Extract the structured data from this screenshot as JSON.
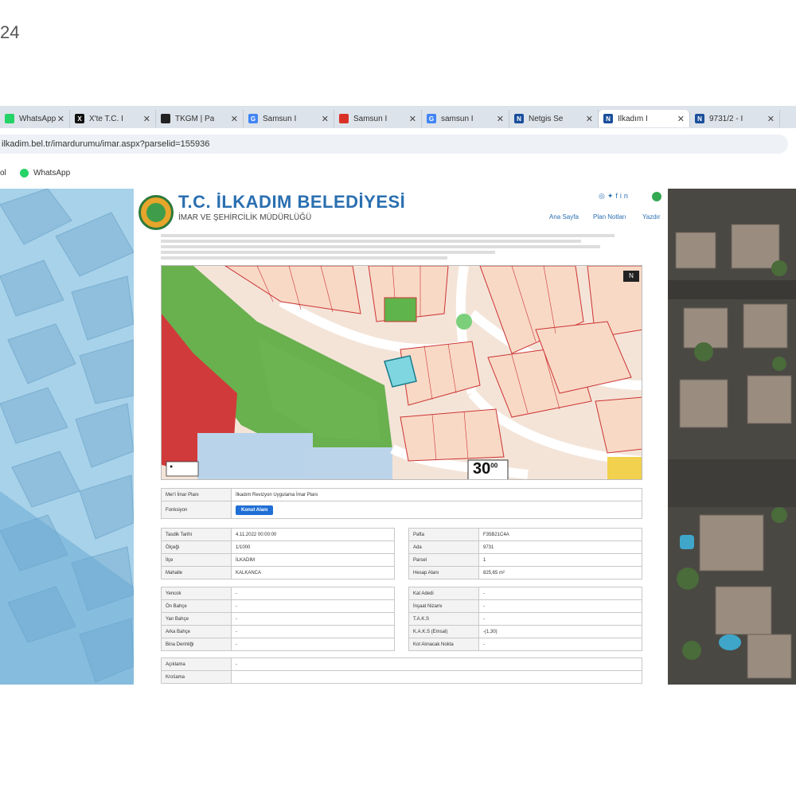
{
  "header_text": "24",
  "browser": {
    "tabs": [
      {
        "label": "WhatsApp",
        "icon": "whatsapp-icon",
        "color": "#25d366",
        "glyph": ""
      },
      {
        "label": "X'te T.C. İ",
        "icon": "x-icon",
        "color": "#111111",
        "glyph": "X"
      },
      {
        "label": "TKGM | Pa",
        "icon": "map-pin-icon",
        "color": "#222222",
        "glyph": ""
      },
      {
        "label": "Samsun İ",
        "icon": "google-icon",
        "color": "#4285f4",
        "glyph": "G"
      },
      {
        "label": "Samsun İ",
        "icon": "site-icon",
        "color": "#d93025",
        "glyph": ""
      },
      {
        "label": "samsun İ",
        "icon": "google-icon",
        "color": "#4285f4",
        "glyph": "G"
      },
      {
        "label": "Netgis Se",
        "icon": "netgis-icon",
        "color": "#1a4f9c",
        "glyph": "N"
      },
      {
        "label": "İlkadım İ",
        "icon": "netgis-icon",
        "color": "#1a4f9c",
        "glyph": "N"
      },
      {
        "label": "9731/2 - İ",
        "icon": "netgis-icon",
        "color": "#1a4f9c",
        "glyph": "N"
      }
    ],
    "url": "ilkadim.bel.tr/imardurumu/imar.aspx?parselid=155936",
    "bookmarks": [
      {
        "label": "ol"
      },
      {
        "label": "WhatsApp"
      }
    ]
  },
  "site": {
    "title": "T.C. İLKADIM BELEDİYESİ",
    "subtitle": "İMAR VE ŞEHİRCİLİK MÜDÜRLÜĞÜ",
    "nav": [
      "Ana Sayfa",
      "Plan Notları",
      "Yazdır"
    ],
    "social_icons": [
      "instagram-icon",
      "twitter-icon",
      "facebook-icon",
      "linkedin-icon"
    ],
    "map": {
      "scale_label": "30",
      "scale_super": "00",
      "north_label": "N"
    },
    "plan": {
      "plan_label": "Mer'i İmar Planı",
      "plan_value": "İlkadım Revizyon Uygulama İmar Planı",
      "function_label": "Fonksiyon",
      "function_button": "Konut Alanı"
    },
    "left_table": [
      {
        "k": "Tasdik Tarihi",
        "v": "4.11.2022 00:00:00"
      },
      {
        "k": "Ölçeği",
        "v": "1/1000"
      },
      {
        "k": "İlçe",
        "v": "İLKADIM"
      },
      {
        "k": "Mahalle",
        "v": "KALKANCA"
      }
    ],
    "right_table": [
      {
        "k": "Pafta",
        "v": "F35B21C4A"
      },
      {
        "k": "Ada",
        "v": "9731"
      },
      {
        "k": "Parsel",
        "v": "1"
      },
      {
        "k": "Hesap Alanı",
        "v": "825,65 m²"
      }
    ],
    "left_table2": [
      {
        "k": "Yencok",
        "v": "-"
      },
      {
        "k": "Ön Bahçe",
        "v": "-"
      },
      {
        "k": "Yan Bahçe",
        "v": "-"
      },
      {
        "k": "Arka Bahçe",
        "v": "-"
      },
      {
        "k": "Bina Derinliği",
        "v": "-"
      }
    ],
    "right_table2": [
      {
        "k": "Kat Adedi",
        "v": "-"
      },
      {
        "k": "İnşaat Nizamı",
        "v": "-"
      },
      {
        "k": "T.A.K.S",
        "v": "-"
      },
      {
        "k": "K.A.K.S (Emsal)",
        "v": "-(1,30)"
      },
      {
        "k": "Kot Alınacak Nokta",
        "v": "-"
      }
    ],
    "notes": [
      {
        "k": "Açıklama",
        "v": "-"
      },
      {
        "k": "Krošama",
        "v": ""
      }
    ]
  }
}
